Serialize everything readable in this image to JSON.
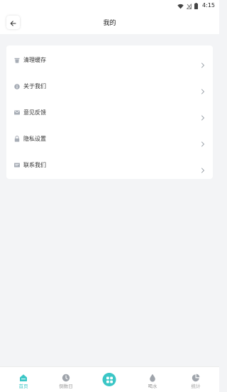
{
  "status_bar": {
    "time": "4:15",
    "icons": [
      "wifi-icon",
      "signal-off-icon",
      "battery-icon"
    ]
  },
  "header": {
    "title": "我的",
    "back_icon": "arrow-left-icon"
  },
  "menu": {
    "items": [
      {
        "label": "清理缓存",
        "icon": "trash-icon"
      },
      {
        "label": "关于我们",
        "icon": "info-icon"
      },
      {
        "label": "意见反馈",
        "icon": "mail-icon"
      },
      {
        "label": "隐私设置",
        "icon": "lock-icon"
      },
      {
        "label": "联系我们",
        "icon": "message-icon"
      }
    ]
  },
  "tabbar": {
    "active_color": "#3bc6c6",
    "tabs": [
      {
        "label": "首页",
        "icon": "home-icon",
        "active": true
      },
      {
        "label": "倒数日",
        "icon": "countdown-icon",
        "active": false
      },
      {
        "label": "",
        "icon": "apps-grid-icon",
        "active": false
      },
      {
        "label": "喝水",
        "icon": "water-drop-icon",
        "active": false
      },
      {
        "label": "统计",
        "icon": "pie-chart-icon",
        "active": false
      }
    ]
  }
}
